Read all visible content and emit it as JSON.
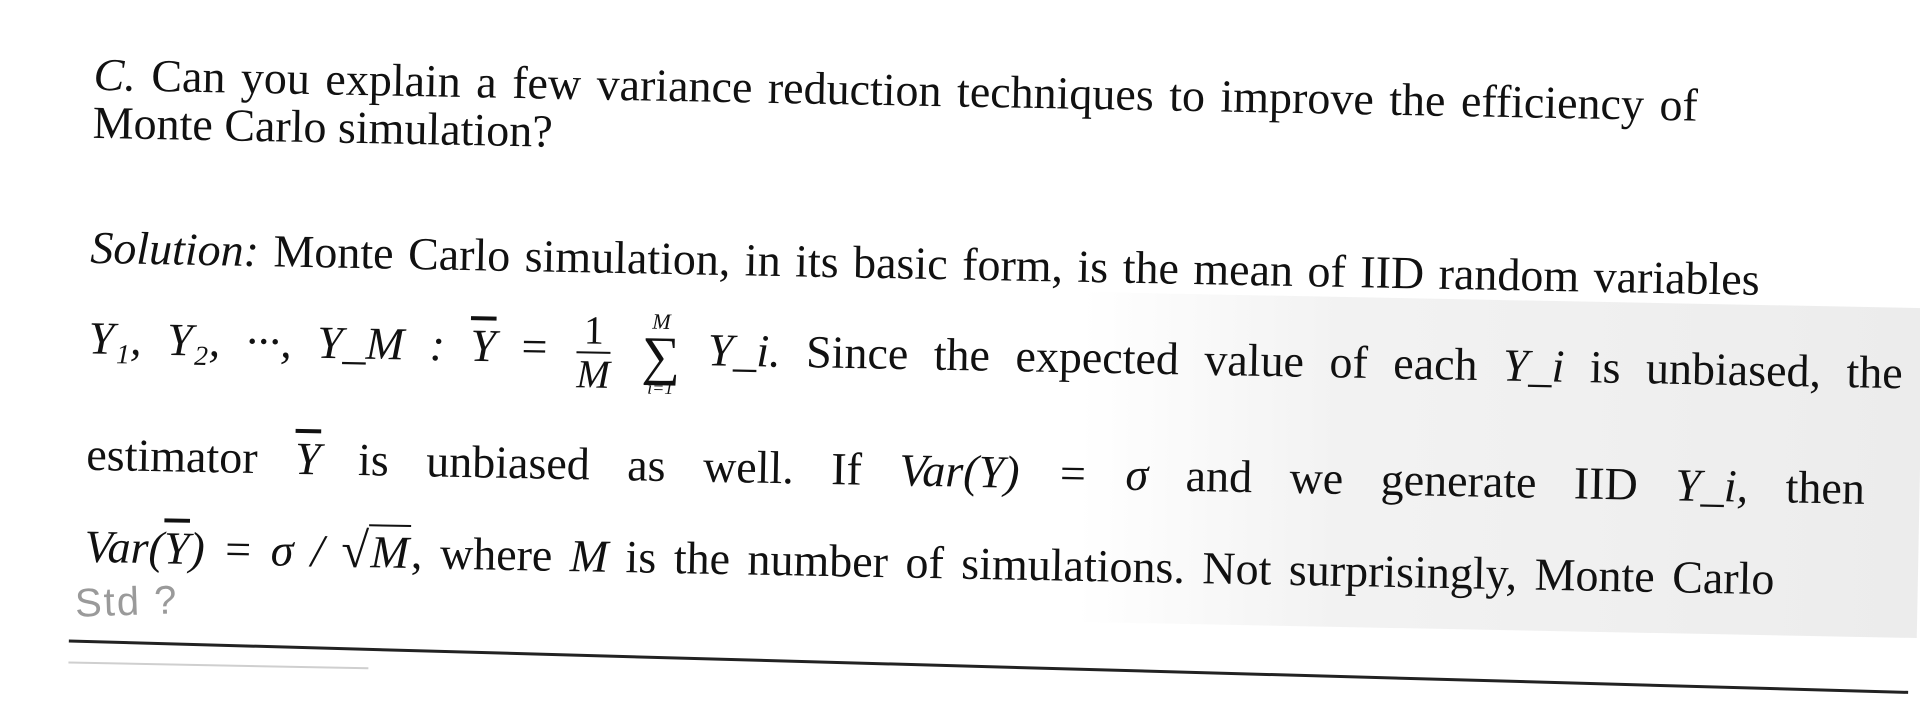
{
  "question": {
    "label": "C.",
    "line1": "Can you explain a few variance reduction techniques to improve the efficiency of",
    "line2": "Monte Carlo simulation?"
  },
  "solution": {
    "label": "Solution:",
    "line1": "Monte Carlo simulation, in its basic form, is the mean of IID random variables",
    "eq_vars": "Y₁, Y₂, ···, Y_M :",
    "eq_lhs": "Y",
    "eq_equals": "=",
    "frac_num": "1",
    "frac_den": "M",
    "sum_upper": "M",
    "sum_symbol": "∑",
    "sum_lower": "i=1",
    "sum_term": "Y_i.",
    "eq_text_a": "Since the expected value of each",
    "eq_text_var": "Y_i",
    "eq_text_b": "is unbiased, the",
    "line4_a": "estimator",
    "line4_var": "Y",
    "line4_b": "is unbiased as well. If",
    "line4_eq": "Var(Y) = σ",
    "line4_c": "and we generate IID",
    "line4_var2": "Y_i,",
    "line4_d": "then",
    "line5_lhs": "Var(",
    "line5_bar": "Y",
    "line5_rhs": ") = σ /",
    "line5_sqrt_sym": "√",
    "line5_sqrt_arg": "M",
    "line5_text_a": ", where",
    "line5_var": "M",
    "line5_text_b": "is the number of simulations. Not surprisingly, Monte Carlo"
  },
  "handwritten_note": "Std ?"
}
